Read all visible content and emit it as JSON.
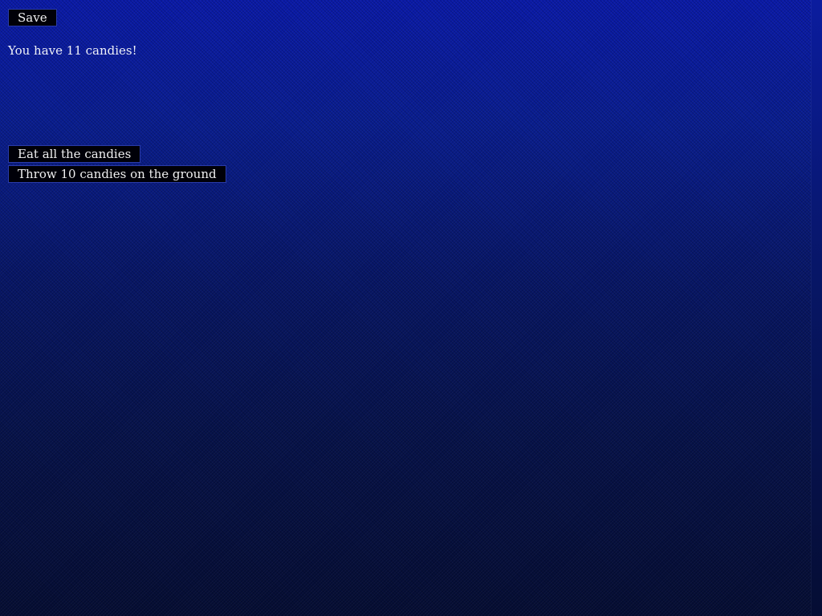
{
  "toolbar": {
    "save_label": "Save"
  },
  "status": {
    "candies_text": "You have 11 candies!"
  },
  "actions": {
    "eat_label": "Eat all the candies",
    "throw_label": "Throw 10 candies on the ground"
  }
}
